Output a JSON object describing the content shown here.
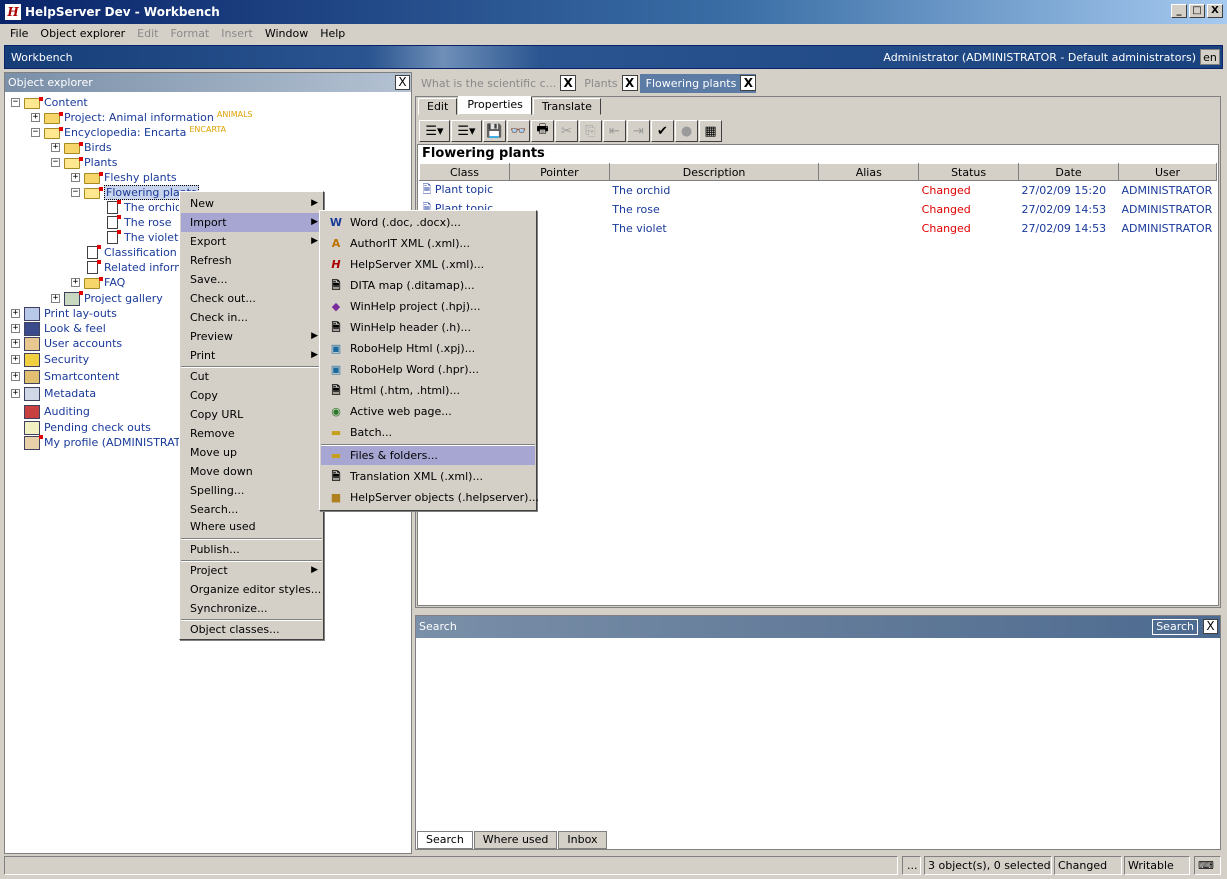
{
  "window": {
    "title": "HelpServer Dev - Workbench",
    "app_icon": "H",
    "minimize": "_",
    "maximize": "□",
    "close": "X"
  },
  "menubar": {
    "items": [
      "File",
      "Object explorer",
      "Edit",
      "Format",
      "Insert",
      "Window",
      "Help"
    ]
  },
  "workbench": {
    "title": "Workbench",
    "user": "Administrator (ADMINISTRATOR - Default administrators)",
    "lang": "en"
  },
  "explorer": {
    "title": "Object explorer",
    "close": "X",
    "tree": [
      {
        "label": "Content",
        "expander": "−"
      },
      {
        "label": "Project: Animal information",
        "tag": "ANIMALS",
        "expander": "+"
      },
      {
        "label": "Encyclopedia: Encarta",
        "tag": "ENCARTA",
        "expander": "−"
      },
      {
        "label": "Birds",
        "expander": "+"
      },
      {
        "label": "Plants",
        "expander": "−"
      },
      {
        "label": "Fleshy plants",
        "expander": "+"
      },
      {
        "label": "Flowering plants",
        "expander": "−"
      },
      {
        "label": "The orchid"
      },
      {
        "label": "The rose"
      },
      {
        "label": "The violet"
      },
      {
        "label": "Classification"
      },
      {
        "label": "Related information"
      },
      {
        "label": "FAQ",
        "expander": "+"
      },
      {
        "label": "Project gallery",
        "expander": "+"
      },
      {
        "label": "Print lay-outs",
        "expander": "+"
      },
      {
        "label": "Look & feel",
        "expander": "+"
      },
      {
        "label": "User accounts",
        "expander": "+"
      },
      {
        "label": "Security",
        "expander": "+"
      },
      {
        "label": "Smartcontent",
        "expander": "+"
      },
      {
        "label": "Metadata",
        "expander": "+"
      },
      {
        "label": "Auditing"
      },
      {
        "label": "Pending check outs"
      },
      {
        "label": "My profile (ADMINISTRATOR)"
      }
    ]
  },
  "doc_tabs": [
    {
      "label": "What is the scientific c...",
      "close": "X"
    },
    {
      "label": "Plants",
      "close": "X"
    },
    {
      "label": "Flowering plants",
      "close": "X"
    }
  ],
  "editor": {
    "tabs": [
      "Edit",
      "Properties",
      "Translate"
    ],
    "title": "Flowering plants",
    "columns": [
      "Class",
      "Pointer",
      "Description",
      "Alias",
      "Status",
      "Date",
      "User"
    ],
    "rows": [
      {
        "class": "Plant topic",
        "pointer": "",
        "description": "The orchid",
        "alias": "",
        "status": "Changed",
        "date": "27/02/09 15:20",
        "user": "ADMINISTRATOR"
      },
      {
        "class": "Plant topic",
        "pointer": "",
        "description": "The rose",
        "alias": "",
        "status": "Changed",
        "date": "27/02/09 14:53",
        "user": "ADMINISTRATOR"
      },
      {
        "class": "Plant topic",
        "pointer": "",
        "description": "The violet",
        "alias": "",
        "status": "Changed",
        "date": "27/02/09 14:53",
        "user": "ADMINISTRATOR"
      }
    ]
  },
  "search": {
    "title": "Search",
    "button": "Search",
    "close": "X",
    "tabs": [
      "Search",
      "Where used",
      "Inbox"
    ]
  },
  "statusbar": {
    "ellipsis": "...",
    "count": "3 object(s), 0 selected",
    "state": "Changed",
    "mode": "Writable"
  },
  "context_menu": {
    "items": [
      "New",
      "Import",
      "Export",
      "Refresh",
      "Save...",
      "Check out...",
      "Check in...",
      "Preview",
      "Print",
      "Cut",
      "Copy",
      "Copy URL",
      "Remove",
      "Move up",
      "Move down",
      "Spelling...",
      "Search...",
      "Where used",
      "Publish...",
      "Project",
      "Organize editor styles...",
      "Synchronize...",
      "Object classes..."
    ]
  },
  "import_menu": {
    "items": [
      "Word (.doc, .docx)...",
      "AuthorIT XML (.xml)...",
      "HelpServer XML (.xml)...",
      "DITA map (.ditamap)...",
      "WinHelp project (.hpj)...",
      "WinHelp header (.h)...",
      "RoboHelp Html (.xpj)...",
      "RoboHelp Word (.hpr)...",
      "Html (.htm, .html)...",
      "Active web page...",
      "Batch...",
      "Files & folders...",
      "Translation XML (.xml)...",
      "HelpServer objects (.helpserver)..."
    ]
  }
}
